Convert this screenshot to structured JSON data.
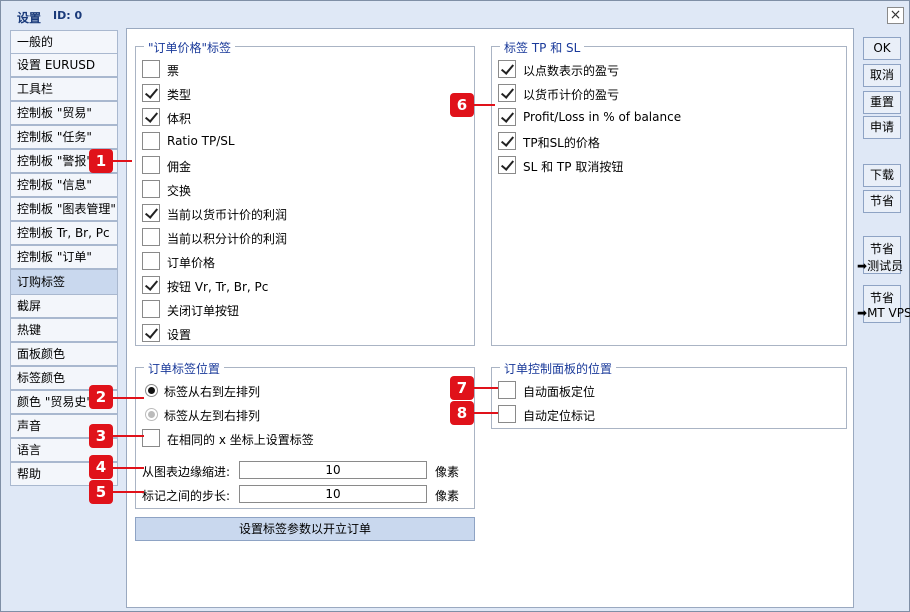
{
  "window": {
    "title": "设置",
    "id_label": "ID: 0",
    "close_label": "×"
  },
  "sidebar": {
    "items": [
      {
        "label": "一般的"
      },
      {
        "label": "设置 EURUSD"
      },
      {
        "label": "工具栏"
      },
      {
        "label": "控制板 \"贸易\""
      },
      {
        "label": "控制板 \"任务\""
      },
      {
        "label": "控制板 \"警报\""
      },
      {
        "label": "控制板 \"信息\""
      },
      {
        "label": "控制板 \"图表管理\""
      },
      {
        "label": "控制板 Tr, Br, Pc"
      },
      {
        "label": "控制板 \"订单\""
      },
      {
        "label": "订购标签"
      },
      {
        "label": "截屏"
      },
      {
        "label": "热键"
      },
      {
        "label": "面板颜色"
      },
      {
        "label": "标签颜色"
      },
      {
        "label": "颜色 \"贸易史\""
      },
      {
        "label": "声音"
      },
      {
        "label": "语言"
      },
      {
        "label": "帮助"
      }
    ],
    "active": "订购标签"
  },
  "order_price_labels": {
    "title": "\"订单价格\"标签",
    "items": [
      {
        "label": "票",
        "checked": false
      },
      {
        "label": "类型",
        "checked": true
      },
      {
        "label": "体积",
        "checked": true
      },
      {
        "label": "Ratio TP/SL",
        "checked": false
      },
      {
        "label": "佣金",
        "checked": false
      },
      {
        "label": "交换",
        "checked": false
      },
      {
        "label": "当前以货币计价的利润",
        "checked": true
      },
      {
        "label": "当前以积分计价的利润",
        "checked": false
      },
      {
        "label": "订单价格",
        "checked": false
      },
      {
        "label": "按钮 Vr, Tr, Br, Pc",
        "checked": true
      },
      {
        "label": "关闭订单按钮",
        "checked": false
      },
      {
        "label": "设置",
        "checked": true
      }
    ]
  },
  "tp_sl_labels": {
    "title": "标签 TP 和 SL",
    "items": [
      {
        "label": "以点数表示的盈亏",
        "checked": true
      },
      {
        "label": "以货币计价的盈亏",
        "checked": true
      },
      {
        "label": "Profit/Loss in % of balance",
        "checked": true
      },
      {
        "label": "TP和SL的价格",
        "checked": true
      },
      {
        "label": "SL 和 TP 取消按钮",
        "checked": true
      }
    ]
  },
  "label_position": {
    "title": "订单标签位置",
    "radio_right_to_left": "标签从右到左排列",
    "radio_left_to_right": "标签从左到右排列",
    "same_x_label": "在相同的 x 坐标上设置标签",
    "indent_label": "从图表边缘缩进:",
    "indent_value": "10",
    "step_label": "标记之间的步长:",
    "step_value": "10",
    "unit": "像素"
  },
  "control_panel_position": {
    "title": "订单控制面板的位置",
    "auto_panel": "自动面板定位",
    "auto_mark": "自动定位标记"
  },
  "apply_button": "设置标签参数以开立订单",
  "right_buttons": {
    "ok": "OK",
    "cancel": "取消",
    "reset": "重置",
    "apply": "申请",
    "download": "下载",
    "save": "节省",
    "save_tester_l1": "节省",
    "save_tester_l2": "测试员",
    "save_vps_l1": "节省",
    "save_vps_l2": "MT VPS"
  },
  "callouts": [
    "1",
    "2",
    "3",
    "4",
    "5",
    "6",
    "7",
    "8"
  ],
  "colors": {
    "accent": "#1a3a9a",
    "callout": "#e0121a",
    "selected_nav": "#c9d8ee",
    "window_bg": "#dfe8f6"
  }
}
